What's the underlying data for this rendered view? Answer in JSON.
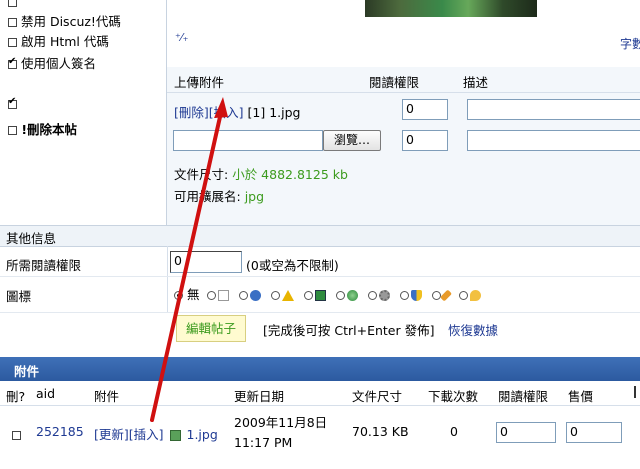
{
  "options": {
    "disable_discuz_code": "禁用 Discuz!代碼",
    "enable_html_code": "啟用 Html 代碼",
    "use_signature": "使用個人簽名",
    "delete_post": "!刪除本帖"
  },
  "editor": {
    "toolbar_symbol": "⁺⁄₊",
    "right_label": "字數"
  },
  "attach_upload": {
    "col_attachment": "上傳附件",
    "col_read_perm": "閱讀權限",
    "col_desc": "描述",
    "row1": {
      "delete": "[刪除]",
      "insert": "[插入]",
      "name": "[1] 1.jpg",
      "perm": "0"
    },
    "row2": {
      "browse": "瀏覽…",
      "perm": "0"
    },
    "size_label": "文件尺寸:",
    "size_value": "小於 4882.8125 kb",
    "ext_label": "可用擴展名:",
    "ext_value": "jpg"
  },
  "other_info": {
    "title": "其他信息",
    "read_perm_label": "所需閱讀權限",
    "read_perm_value": "0",
    "read_perm_hint": "(0或空為不限制)",
    "icon_label": "圖標",
    "icon_none": "無",
    "icon_names": [
      "page-icon",
      "help-icon",
      "warning-icon",
      "picture-icon",
      "globe-icon",
      "gear-icon",
      "shield-icon",
      "pen-icon",
      "speech-icon"
    ]
  },
  "actions": {
    "edit_post": "編輯帖子",
    "hint": "[完成後可按 Ctrl+Enter 發佈]",
    "restore": "恢復數據"
  },
  "attachments": {
    "title": "附件",
    "headers": [
      "刪?",
      "aid",
      "附件",
      "更新日期",
      "文件尺寸",
      "下載次數",
      "閱讀權限",
      "售價"
    ],
    "row": {
      "aid": "252185",
      "update": "[更新]",
      "insert": "[插入]",
      "file": "1.jpg",
      "date_line1": "2009年11月8日",
      "date_line2": "11:17 PM",
      "size": "70.13 KB",
      "downloads": "0",
      "perm": "0",
      "price": "0"
    }
  },
  "colors": {
    "header_bar": "#2c5aa0",
    "arrow": "#d01010"
  }
}
